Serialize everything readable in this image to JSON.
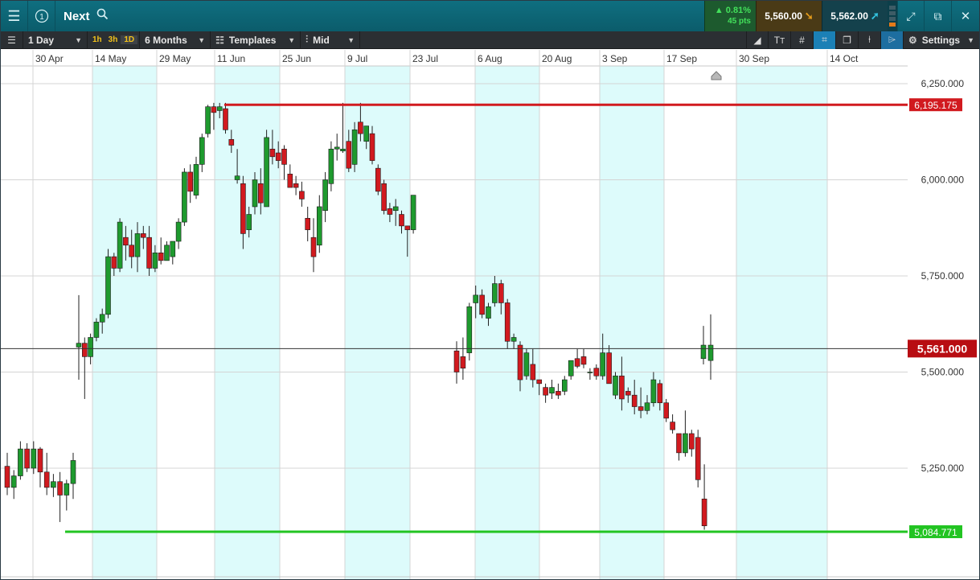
{
  "window": {
    "title": "Next",
    "info_icon": "info-circle-icon",
    "menu_icon": "hamburger-icon",
    "search_icon": "search-icon"
  },
  "quote": {
    "change_pct": "▲ 0.81%",
    "change_pts": "45 pts",
    "sell": "5,560.00",
    "buy": "5,562.00"
  },
  "toolbar": {
    "interval": "1 Day",
    "tf_1h": "1h",
    "tf_3h": "3h",
    "tf_1d": "1D",
    "range": "6 Months",
    "templates": "Templates",
    "price_type": "Mid",
    "settings": "Settings"
  },
  "chart_data": {
    "type": "candlestick",
    "x_labels": [
      "30 Apr",
      "14 May",
      "29 May",
      "11 Jun",
      "25 Jun",
      "9 Jul",
      "23 Jul",
      "6 Aug",
      "20 Aug",
      "3 Sep",
      "17 Sep",
      "30 Sep",
      "14 Oct"
    ],
    "y_ticks": [
      "6,250.000",
      "6,000.000",
      "5,750.000",
      "5,500.000",
      "5,250.000"
    ],
    "y_tick_values": [
      6250,
      6000,
      5750,
      5500,
      5250
    ],
    "ylim": [
      5020,
      6290
    ],
    "current_price": 5561.0,
    "current_price_label": "5,561.000",
    "resistance": 6195.175,
    "resistance_label": "6,195.175",
    "support": 5084.771,
    "support_label": "5,084.771",
    "colors": {
      "up": "#1e9a2e",
      "down": "#d11a1f",
      "resistance": "#d11a1f",
      "support": "#22c422",
      "shade": "#ddfbfb"
    },
    "candles": [
      [
        5255,
        5290,
        5180,
        5200
      ],
      [
        5200,
        5245,
        5170,
        5230
      ],
      [
        5230,
        5320,
        5220,
        5300
      ],
      [
        5300,
        5315,
        5240,
        5250
      ],
      [
        5250,
        5320,
        5235,
        5300
      ],
      [
        5300,
        5305,
        5200,
        5240
      ],
      [
        5240,
        5290,
        5180,
        5200
      ],
      [
        5200,
        5235,
        5175,
        5215
      ],
      [
        5215,
        5240,
        5110,
        5180
      ],
      [
        5180,
        5220,
        5140,
        5210
      ],
      [
        5210,
        5290,
        5170,
        5270
      ],
      [
        5565,
        5700,
        5480,
        5575
      ],
      [
        5575,
        5590,
        5430,
        5540
      ],
      [
        5540,
        5600,
        5520,
        5590
      ],
      [
        5590,
        5640,
        5580,
        5630
      ],
      [
        5630,
        5665,
        5600,
        5650
      ],
      [
        5650,
        5820,
        5640,
        5800
      ],
      [
        5800,
        5810,
        5750,
        5770
      ],
      [
        5770,
        5900,
        5760,
        5890
      ],
      [
        5850,
        5880,
        5790,
        5830
      ],
      [
        5830,
        5870,
        5770,
        5800
      ],
      [
        5800,
        5890,
        5760,
        5860
      ],
      [
        5860,
        5880,
        5820,
        5850
      ],
      [
        5850,
        5880,
        5750,
        5770
      ],
      [
        5770,
        5830,
        5760,
        5810
      ],
      [
        5810,
        5850,
        5780,
        5790
      ],
      [
        5790,
        5840,
        5790,
        5830
      ],
      [
        5800,
        5830,
        5780,
        5840
      ],
      [
        5840,
        5900,
        5820,
        5890
      ],
      [
        5890,
        6030,
        5880,
        6020
      ],
      [
        6020,
        6040,
        5940,
        5970
      ],
      [
        5960,
        6060,
        5950,
        6040
      ],
      [
        6040,
        6120,
        6020,
        6110
      ],
      [
        6120,
        6195,
        6110,
        6190
      ],
      [
        6190,
        6200,
        6130,
        6175
      ],
      [
        6180,
        6200,
        6160,
        6190
      ],
      [
        6185,
        6200,
        6120,
        6130
      ],
      [
        6105,
        6130,
        6070,
        6090
      ],
      [
        6000,
        6080,
        5990,
        6010
      ],
      [
        5990,
        6010,
        5820,
        5860
      ],
      [
        5870,
        5930,
        5850,
        5910
      ],
      [
        5930,
        6020,
        5910,
        6000
      ],
      [
        5990,
        6030,
        5910,
        5940
      ],
      [
        5930,
        6130,
        5950,
        6110
      ],
      [
        6080,
        6130,
        6040,
        6060
      ],
      [
        6070,
        6100,
        6030,
        6050
      ],
      [
        6080,
        6090,
        6000,
        6040
      ],
      [
        6015,
        6040,
        5990,
        5980
      ],
      [
        5990,
        6010,
        5960,
        5980
      ],
      [
        5970,
        5995,
        5930,
        5950
      ],
      [
        5900,
        5930,
        5840,
        5870
      ],
      [
        5850,
        5900,
        5760,
        5800
      ],
      [
        5830,
        5960,
        5810,
        5930
      ],
      [
        5920,
        6020,
        5890,
        6000
      ],
      [
        5990,
        6100,
        5970,
        6080
      ],
      [
        6080,
        6120,
        6050,
        6085
      ],
      [
        6075,
        6200,
        6070,
        6080
      ],
      [
        6100,
        6130,
        6020,
        6030
      ],
      [
        6040,
        6150,
        6020,
        6130
      ],
      [
        6150,
        6200,
        6100,
        6120
      ],
      [
        6100,
        6140,
        6080,
        6140
      ],
      [
        6120,
        6140,
        6040,
        6050
      ],
      [
        6030,
        6040,
        5960,
        5970
      ],
      [
        5990,
        6000,
        5910,
        5920
      ],
      [
        5925,
        5940,
        5890,
        5910
      ],
      [
        5920,
        5950,
        5880,
        5930
      ],
      [
        5910,
        5920,
        5860,
        5880
      ],
      [
        5880,
        5880,
        5800,
        5870
      ],
      [
        5870,
        5960,
        5860,
        5960
      ],
      [
        5555,
        5580,
        5470,
        5500
      ],
      [
        5540,
        5590,
        5480,
        5510
      ],
      [
        5550,
        5680,
        5530,
        5670
      ],
      [
        5680,
        5725,
        5640,
        5700
      ],
      [
        5700,
        5715,
        5640,
        5650
      ],
      [
        5640,
        5680,
        5620,
        5670
      ],
      [
        5680,
        5750,
        5670,
        5730
      ],
      [
        5730,
        5740,
        5650,
        5680
      ],
      [
        5680,
        5690,
        5560,
        5580
      ],
      [
        5580,
        5600,
        5560,
        5590
      ],
      [
        5570,
        5580,
        5450,
        5480
      ],
      [
        5490,
        5560,
        5480,
        5550
      ],
      [
        5520,
        5560,
        5460,
        5480
      ],
      [
        5480,
        5480,
        5440,
        5470
      ],
      [
        5460,
        5470,
        5420,
        5440
      ],
      [
        5445,
        5480,
        5430,
        5460
      ],
      [
        5450,
        5470,
        5430,
        5440
      ],
      [
        5450,
        5490,
        5440,
        5480
      ],
      [
        5490,
        5530,
        5480,
        5530
      ],
      [
        5535,
        5560,
        5510,
        5515
      ],
      [
        5540,
        5560,
        5510,
        5520
      ],
      [
        5500,
        5510,
        5480,
        5500
      ],
      [
        5510,
        5520,
        5480,
        5490
      ],
      [
        5490,
        5600,
        5480,
        5550
      ],
      [
        5550,
        5570,
        5470,
        5470
      ],
      [
        5440,
        5500,
        5430,
        5490
      ],
      [
        5490,
        5540,
        5400,
        5430
      ],
      [
        5450,
        5460,
        5420,
        5440
      ],
      [
        5440,
        5480,
        5390,
        5410
      ],
      [
        5410,
        5460,
        5380,
        5400
      ],
      [
        5400,
        5440,
        5390,
        5420
      ],
      [
        5420,
        5500,
        5410,
        5480
      ],
      [
        5470,
        5480,
        5400,
        5420
      ],
      [
        5420,
        5430,
        5370,
        5380
      ],
      [
        5370,
        5390,
        5340,
        5350
      ],
      [
        5340,
        5340,
        5270,
        5290
      ],
      [
        5290,
        5400,
        5280,
        5340
      ],
      [
        5340,
        5350,
        5280,
        5300
      ],
      [
        5330,
        5350,
        5200,
        5220
      ],
      [
        5170,
        5260,
        5090,
        5100
      ],
      [
        5530,
        5650,
        5480,
        5570
      ],
      [
        5535,
        5620,
        5520,
        5570
      ]
    ]
  }
}
